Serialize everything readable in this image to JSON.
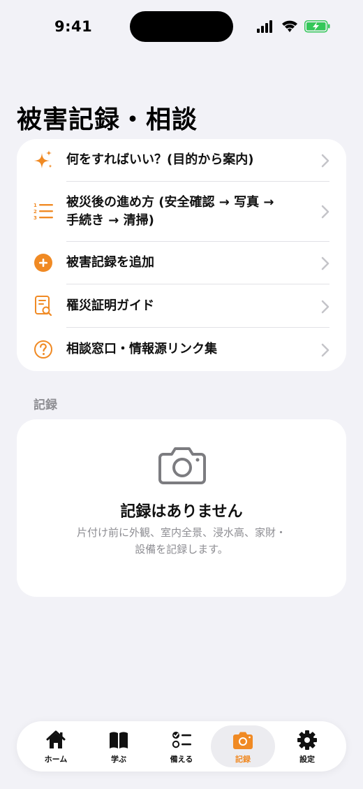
{
  "status_bar": {
    "time": "9:41"
  },
  "page": {
    "title": "被害記録・相談"
  },
  "menu": {
    "items": [
      {
        "icon": "sparkles-icon",
        "label": "何をすればいい？(目的から案内)"
      },
      {
        "icon": "numbered-list-icon",
        "label_line1": "被災後の進め方 (安全確認 → 写真 →",
        "label_line2": "手続き → 清掃)"
      },
      {
        "icon": "plus-circle-icon",
        "label": "被害記録を追加"
      },
      {
        "icon": "document-search-icon",
        "label": "罹災証明ガイド"
      },
      {
        "icon": "question-circle-icon",
        "label": "相談窓口・情報源リンク集"
      }
    ]
  },
  "records": {
    "section_header": "記録",
    "empty_title": "記録はありません",
    "empty_desc_line1": "片付け前に外観、室内全景、浸水高、家財・",
    "empty_desc_line2": "設備を記録します。"
  },
  "tabs": [
    {
      "icon": "house-icon",
      "label": "ホーム"
    },
    {
      "icon": "book-icon",
      "label": "学ぶ"
    },
    {
      "icon": "checklist-icon",
      "label": "備える"
    },
    {
      "icon": "camera-icon",
      "label": "記録",
      "active": true
    },
    {
      "icon": "gear-icon",
      "label": "設定"
    }
  ],
  "colors": {
    "accent": "#f08a24",
    "background": "#f2f2f7",
    "battery": "#34c759"
  }
}
